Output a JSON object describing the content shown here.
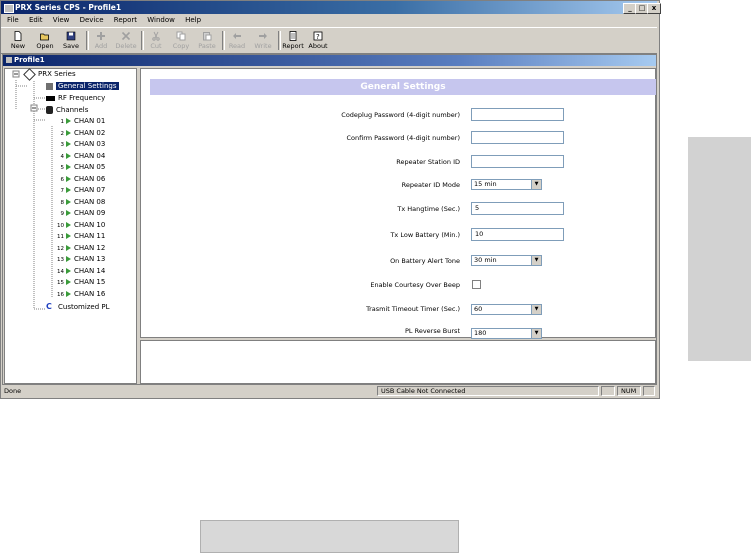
{
  "window": {
    "title": "PRX Series CPS - Profile1",
    "buttons": [
      "_",
      "□",
      "x"
    ]
  },
  "menu": [
    "File",
    "Edit",
    "View",
    "Device",
    "Report",
    "Window",
    "Help"
  ],
  "toolbar": [
    {
      "label": "New",
      "icon": "new-icon",
      "enabled": true
    },
    {
      "label": "Open",
      "icon": "open-icon",
      "enabled": true
    },
    {
      "label": "Save",
      "icon": "save-icon",
      "enabled": true
    },
    {
      "label": "Add",
      "icon": "add-icon",
      "enabled": false
    },
    {
      "label": "Delete",
      "icon": "delete-icon",
      "enabled": false
    },
    {
      "label": "Cut",
      "icon": "cut-icon",
      "enabled": false
    },
    {
      "label": "Copy",
      "icon": "copy-icon",
      "enabled": false
    },
    {
      "label": "Paste",
      "icon": "paste-icon",
      "enabled": false
    },
    {
      "label": "Read",
      "icon": "read-icon",
      "enabled": false
    },
    {
      "label": "Write",
      "icon": "write-icon",
      "enabled": false
    },
    {
      "label": "Report",
      "icon": "report-icon",
      "enabled": true
    },
    {
      "label": "About",
      "icon": "about-icon",
      "enabled": true
    }
  ],
  "child_title": "Profile1",
  "tree": {
    "root": "PRX Series",
    "general": "General Settings",
    "rf": "RF Frequency",
    "channels_label": "Channels",
    "channels": [
      {
        "num": "1",
        "name": "CHAN 01"
      },
      {
        "num": "2",
        "name": "CHAN 02"
      },
      {
        "num": "3",
        "name": "CHAN 03"
      },
      {
        "num": "4",
        "name": "CHAN 04"
      },
      {
        "num": "5",
        "name": "CHAN 05"
      },
      {
        "num": "6",
        "name": "CHAN 06"
      },
      {
        "num": "7",
        "name": "CHAN 07"
      },
      {
        "num": "8",
        "name": "CHAN 08"
      },
      {
        "num": "9",
        "name": "CHAN 09"
      },
      {
        "num": "10",
        "name": "CHAN 10"
      },
      {
        "num": "11",
        "name": "CHAN 11"
      },
      {
        "num": "12",
        "name": "CHAN 12"
      },
      {
        "num": "13",
        "name": "CHAN 13"
      },
      {
        "num": "14",
        "name": "CHAN 14"
      },
      {
        "num": "15",
        "name": "CHAN 15"
      },
      {
        "num": "16",
        "name": "CHAN 16"
      }
    ],
    "customized": "Customized PL"
  },
  "form": {
    "header": "General Settings",
    "fields": [
      {
        "label": "Codeplug Password (4-digit number)",
        "type": "text",
        "value": ""
      },
      {
        "label": "Confirm Password (4-digit number)",
        "type": "text",
        "value": ""
      },
      {
        "label": "Repeater Station ID",
        "type": "text",
        "value": ""
      },
      {
        "label": "Repeater ID Mode",
        "type": "select",
        "value": "15 min"
      },
      {
        "label": "Tx Hangtime (Sec.)",
        "type": "text",
        "value": "5"
      },
      {
        "label": "Tx Low Battery (Min.)",
        "type": "text",
        "value": "10"
      },
      {
        "label": "On Battery Alert Tone",
        "type": "select",
        "value": "30 min"
      },
      {
        "label": "Enable Courtesy Over Beep",
        "type": "checkbox",
        "value": ""
      },
      {
        "label": "Trasmit Timeout Timer (Sec.)",
        "type": "select",
        "value": "60"
      },
      {
        "label": "PL Reverse Burst",
        "type": "select",
        "value": "180"
      }
    ]
  },
  "status": {
    "left": "Done",
    "cable": "USB Cable Not Connected",
    "num": "NUM"
  }
}
